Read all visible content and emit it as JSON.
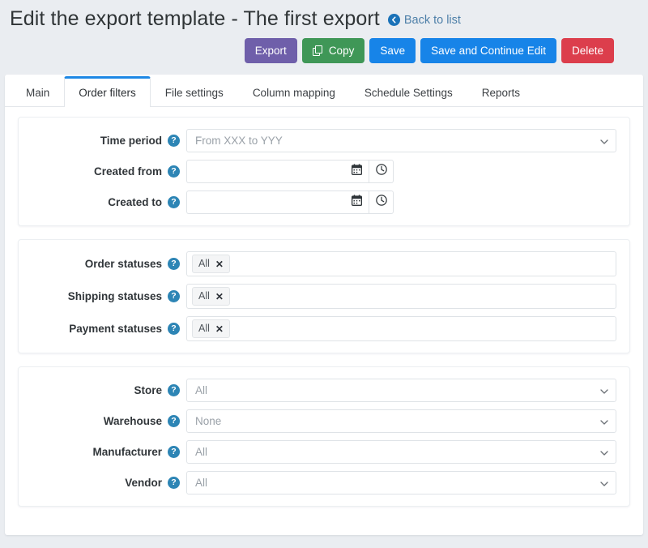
{
  "header": {
    "title": "Edit the export template - The first export",
    "back_link": "Back to list",
    "back_icon": "arrow-left-circle-icon"
  },
  "toolbar": {
    "export_label": "Export",
    "copy_label": "Copy",
    "copy_icon": "copy-icon",
    "save_label": "Save",
    "save_continue_label": "Save and Continue Edit",
    "delete_label": "Delete",
    "colors": {
      "export": "#6f5faa",
      "copy": "#3f9757",
      "save": "#1784e8",
      "save_continue": "#1784e8",
      "delete": "#dc3e4c",
      "accent": "#1e88e5",
      "help": "#2d85b5",
      "link": "#4d7fa8"
    }
  },
  "tabs": [
    {
      "label": "Main",
      "active": false
    },
    {
      "label": "Order filters",
      "active": true
    },
    {
      "label": "File settings",
      "active": false
    },
    {
      "label": "Column mapping",
      "active": false
    },
    {
      "label": "Schedule Settings",
      "active": false
    },
    {
      "label": "Reports",
      "active": false
    }
  ],
  "cards": [
    {
      "rows": [
        {
          "label": "Time period",
          "help": "?",
          "control": "select",
          "value": "From XXX to YYY",
          "icon": "chevron-down-icon"
        },
        {
          "label": "Created from",
          "help": "?",
          "control": "datetime",
          "value": "",
          "placeholder": "",
          "icons": [
            "calendar-icon",
            "clock-icon"
          ]
        },
        {
          "label": "Created to",
          "help": "?",
          "control": "datetime",
          "value": "",
          "placeholder": "",
          "icons": [
            "calendar-icon",
            "clock-icon"
          ]
        }
      ]
    },
    {
      "rows": [
        {
          "label": "Order statuses",
          "help": "?",
          "control": "tags",
          "tags": [
            {
              "text": "All",
              "remove": "✕"
            }
          ]
        },
        {
          "label": "Shipping statuses",
          "help": "?",
          "control": "tags",
          "tags": [
            {
              "text": "All",
              "remove": "✕"
            }
          ]
        },
        {
          "label": "Payment statuses",
          "help": "?",
          "control": "tags",
          "tags": [
            {
              "text": "All",
              "remove": "✕"
            }
          ]
        }
      ]
    },
    {
      "rows": [
        {
          "label": "Store",
          "help": "?",
          "control": "select",
          "value": "All",
          "icon": "chevron-down-icon"
        },
        {
          "label": "Warehouse",
          "help": "?",
          "control": "select",
          "value": "None",
          "icon": "chevron-down-icon"
        },
        {
          "label": "Manufacturer",
          "help": "?",
          "control": "select",
          "value": "All",
          "icon": "chevron-down-icon"
        },
        {
          "label": "Vendor",
          "help": "?",
          "control": "select",
          "value": "All",
          "icon": "chevron-down-icon"
        }
      ]
    }
  ]
}
